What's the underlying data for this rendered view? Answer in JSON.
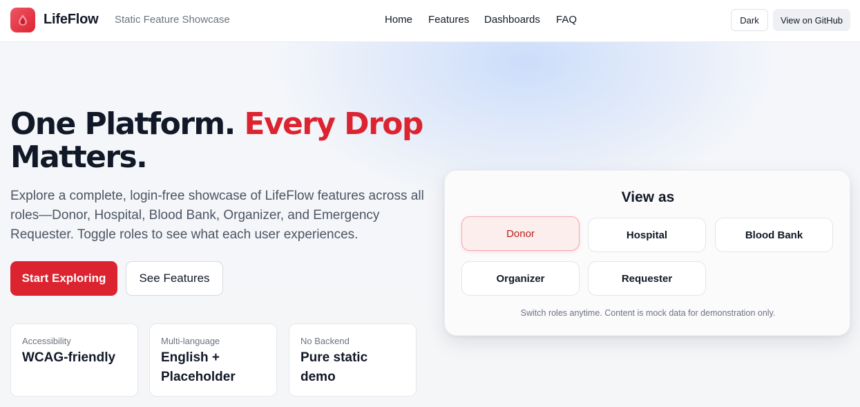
{
  "header": {
    "brand": "LifeFlow",
    "tagline": "Static Feature Showcase",
    "nav": [
      "Home",
      "Features",
      "Dashboards",
      "FAQ"
    ],
    "theme_toggle": "Dark",
    "github_link": "View on GitHub"
  },
  "hero": {
    "headline_part1": "One Platform.",
    "headline_accent": "Every Drop",
    "headline_part2": "Matters.",
    "lead": "Explore a complete, login-free showcase of LifeFlow features across all roles—Donor, Hospital, Blood Bank, Organizer, and Emergency Requester. Toggle roles to see what each user experiences.",
    "primary_cta": "Start Exploring",
    "secondary_cta": "See Features"
  },
  "stats": [
    {
      "label": "Accessibility",
      "value": "WCAG-friendly"
    },
    {
      "label": "Multi-language",
      "value": "English + Placeholder"
    },
    {
      "label": "No Backend",
      "value": "Pure static demo"
    }
  ],
  "role_card": {
    "title": "View as",
    "roles": [
      "Donor",
      "Hospital",
      "Blood Bank",
      "Organizer",
      "Requester"
    ],
    "selected": "Donor",
    "note": "Switch roles anytime. Content is mock data for demonstration only."
  },
  "colors": {
    "accent": "#dc2330",
    "text": "#111827",
    "muted": "#6b7280"
  },
  "icons": {
    "logo": "blood-drop-icon"
  }
}
